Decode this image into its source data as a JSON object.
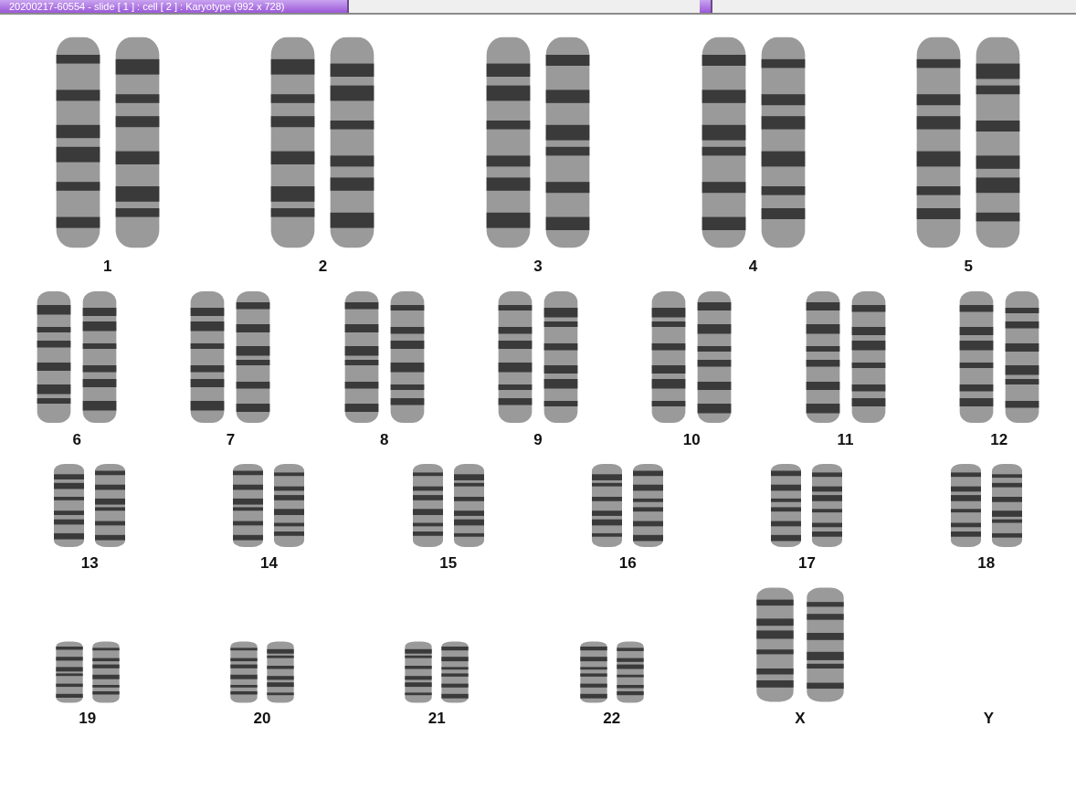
{
  "window": {
    "title": "20200217-60554 - slide [ 1 ] : cell [ 2 ] : Karyotype  (992 x 728)"
  },
  "karyotype": {
    "rows": [
      {
        "pairs": [
          {
            "label": "1",
            "kind": "pair"
          },
          {
            "label": "2",
            "kind": "pair"
          },
          {
            "label": "3",
            "kind": "pair"
          },
          {
            "label": "4",
            "kind": "pair"
          },
          {
            "label": "5",
            "kind": "pair"
          }
        ]
      },
      {
        "pairs": [
          {
            "label": "6",
            "kind": "pair"
          },
          {
            "label": "7",
            "kind": "pair"
          },
          {
            "label": "8",
            "kind": "pair"
          },
          {
            "label": "9",
            "kind": "pair"
          },
          {
            "label": "10",
            "kind": "pair"
          },
          {
            "label": "11",
            "kind": "pair"
          },
          {
            "label": "12",
            "kind": "pair"
          }
        ]
      },
      {
        "pairs": [
          {
            "label": "13",
            "kind": "pair"
          },
          {
            "label": "14",
            "kind": "pair"
          },
          {
            "label": "15",
            "kind": "pair"
          },
          {
            "label": "16",
            "kind": "pair"
          },
          {
            "label": "17",
            "kind": "pair"
          },
          {
            "label": "18",
            "kind": "pair"
          }
        ]
      },
      {
        "pairs": [
          {
            "label": "19",
            "kind": "pair"
          },
          {
            "label": "20",
            "kind": "pair"
          },
          {
            "label": "21",
            "kind": "pair"
          },
          {
            "label": "22",
            "kind": "pair"
          },
          {
            "label": "X",
            "kind": "pair"
          },
          {
            "label": "Y",
            "kind": "empty"
          }
        ]
      }
    ]
  }
}
